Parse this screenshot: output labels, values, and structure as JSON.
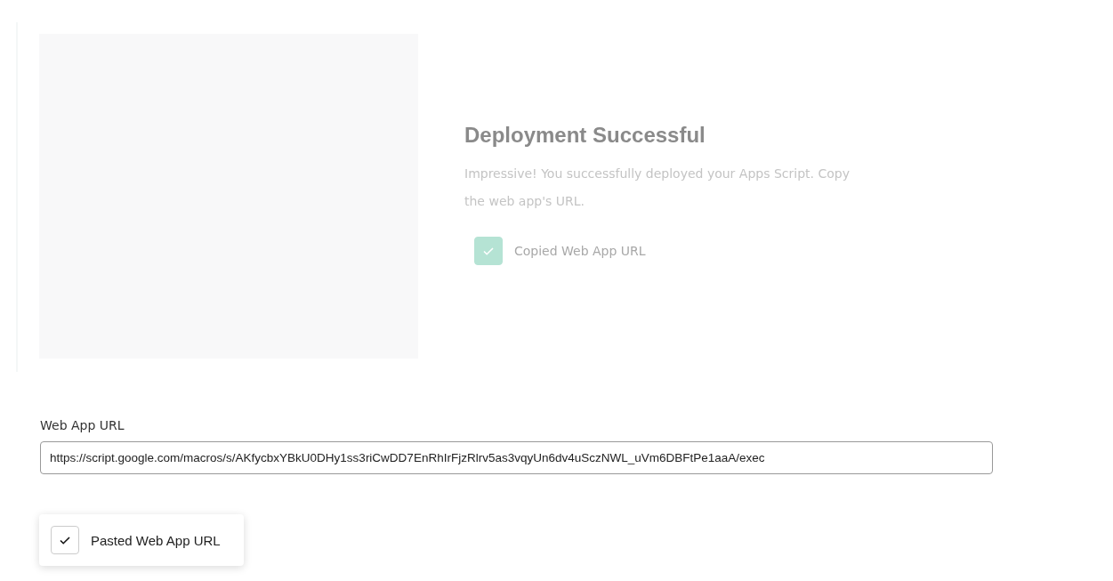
{
  "step": {
    "title": "Deployment Successful",
    "description": "Impressive! You successfully deployed your Apps Script. Copy the web app's URL.",
    "checkbox": {
      "label": "Copied Web App URL",
      "checked": true
    }
  },
  "url_field": {
    "label": "Web App URL",
    "value": "https://script.google.com/macros/s/AKfycbxYBkU0DHy1ss3riCwDD7EnRhIrFjzRlrv5as3vqyUn6dv4uSczNWL_uVm6DBFtPe1aaA/exec"
  },
  "confirm": {
    "label": "Pasted Web App URL",
    "checked": true
  }
}
